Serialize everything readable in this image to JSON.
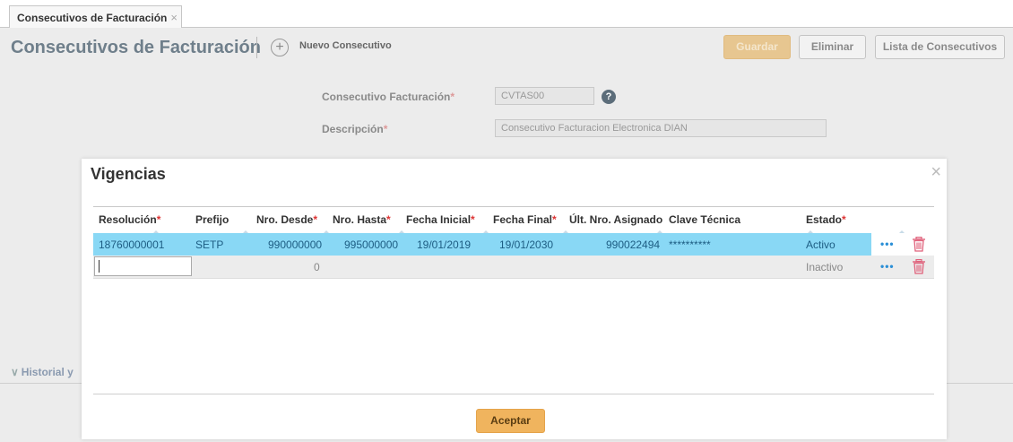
{
  "tab": {
    "title": "Consecutivos de Facturación",
    "close": "×"
  },
  "header": {
    "title": "Consecutivos de Facturación",
    "new_label": "Nuevo Consecutivo",
    "plus": "+",
    "guardar": "Guardar",
    "eliminar": "Eliminar",
    "lista": "Lista de Consecutivos"
  },
  "form": {
    "consecutivo_label": "Consecutivo Facturación",
    "consecutivo_value": "CVTAS00",
    "descripcion_label": "Descripción",
    "descripcion_value": "Consecutivo Facturacion Electronica DIAN",
    "required_mark": "*",
    "help": "?"
  },
  "historial": {
    "label": "Historial y",
    "chevron": "∨"
  },
  "modal": {
    "title": "Vigencias",
    "close": "×",
    "accept": "Aceptar",
    "columns": [
      {
        "label": "Resolución",
        "required": true
      },
      {
        "label": "Prefijo",
        "required": false
      },
      {
        "label": "Nro. Desde",
        "required": true
      },
      {
        "label": "Nro. Hasta",
        "required": true
      },
      {
        "label": "Fecha Inicial",
        "required": true
      },
      {
        "label": "Fecha Final",
        "required": true
      },
      {
        "label": "Últ. Nro. Asignado",
        "required": false
      },
      {
        "label": "Clave Técnica",
        "required": false
      },
      {
        "label": "Estado",
        "required": true
      }
    ],
    "rows": [
      {
        "resolucion": "18760000001",
        "prefijo": "SETP",
        "desde": "990000000",
        "hasta": "995000000",
        "fecha_inicial": "19/01/2019",
        "fecha_final": "19/01/2030",
        "ultimo": "990022494",
        "clave": "**********",
        "estado": "Activo",
        "actions": "•••"
      },
      {
        "resolucion": "",
        "prefijo": "",
        "desde": "0",
        "hasta": "",
        "fecha_inicial": "",
        "fecha_final": "",
        "ultimo": "",
        "clave": "",
        "estado": "Inactivo",
        "actions": "•••"
      }
    ]
  },
  "colors": {
    "selected_row": "#89d8f5",
    "accent_button": "#f0b45e",
    "required": "#d33333",
    "trash": "#e0607a"
  }
}
